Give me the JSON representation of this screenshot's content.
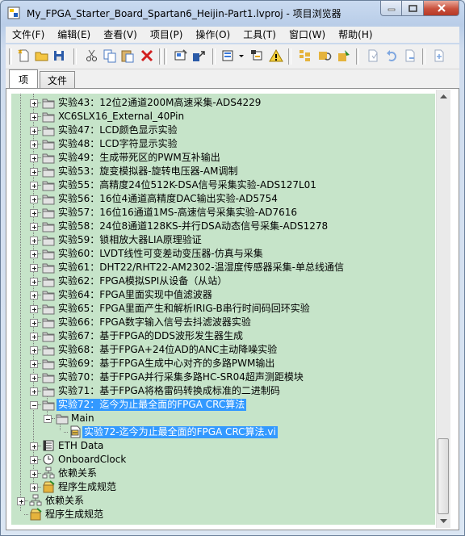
{
  "window": {
    "title": "My_FPGA_Starter_Board_Spartan6_Heijin-Part1.lvproj - 项目浏览器"
  },
  "menu": [
    "文件(F)",
    "编辑(E)",
    "查看(V)",
    "项目(P)",
    "操作(O)",
    "工具(T)",
    "窗口(W)",
    "帮助(H)"
  ],
  "toolbar": {
    "buttons": [
      "new-file",
      "open-folder",
      "save-all",
      "cut",
      "copy",
      "paste",
      "delete",
      "build",
      "deploy",
      "view-dropdown",
      "filter",
      "warning",
      "add-files",
      "refresh",
      "properties",
      "file-view",
      "undo",
      "redo",
      "add-item"
    ]
  },
  "tabs": [
    "项",
    "文件"
  ],
  "tree": {
    "items": [
      {
        "label": "实验43：12位2通道200M高速采集-ADS4229",
        "icon": "folder-icon"
      },
      {
        "label": "XC6SLX16_External_40Pin",
        "icon": "folder-icon"
      },
      {
        "label": "实验47：LCD颜色显示实验",
        "icon": "folder-icon"
      },
      {
        "label": "实验48：LCD字符显示实验",
        "icon": "folder-icon"
      },
      {
        "label": "实验49：生成带死区的PWM互补输出",
        "icon": "folder-icon"
      },
      {
        "label": "实验53：旋变模拟器-旋转电压器-AM调制",
        "icon": "folder-icon"
      },
      {
        "label": "实验55：高精度24位512K-DSA信号采集实验-ADS127L01",
        "icon": "folder-icon"
      },
      {
        "label": "实验56：16位4通道高精度DAC输出实验-AD5754",
        "icon": "folder-icon"
      },
      {
        "label": "实验57：16位16通道1MS-高速信号采集实验-AD7616",
        "icon": "folder-icon"
      },
      {
        "label": "实验58：24位8通道128KS-并行DSA动态信号采集-ADS1278",
        "icon": "folder-icon"
      },
      {
        "label": "实验59：锁相放大器LIA原理验证",
        "icon": "folder-icon"
      },
      {
        "label": "实验60：LVDT线性可变差动变压器-仿真与采集",
        "icon": "folder-icon"
      },
      {
        "label": "实验61：DHT22/RHT22-AM2302-温湿度传感器采集-单总线通信",
        "icon": "folder-icon"
      },
      {
        "label": "实验62：FPGA模拟SPI从设备（从站）",
        "icon": "folder-icon"
      },
      {
        "label": "实验64：FPGA里面实现中值滤波器",
        "icon": "folder-icon"
      },
      {
        "label": "实验65：FPGA里面产生和解析IRIG-B串行时间码回环实验",
        "icon": "folder-icon"
      },
      {
        "label": "实验66：FPGA数字输入信号去抖滤波器实验",
        "icon": "folder-icon"
      },
      {
        "label": "实验67：基于FPGA的DDS波形发生器生成",
        "icon": "folder-icon"
      },
      {
        "label": "实验68：基于FPGA+24位AD的ANC主动降噪实验",
        "icon": "folder-icon"
      },
      {
        "label": "实验69：基于FPGA生成中心对齐的多路PWM输出",
        "icon": "folder-icon"
      },
      {
        "label": "实验70：基于FPGA并行采集多路HC-SR04超声测距模块",
        "icon": "folder-icon"
      },
      {
        "label": "实验71：基于FPGA将格雷码转换成标准的二进制码",
        "icon": "folder-icon"
      },
      {
        "label": "实验72：迄今为止最全面的FPGA CRC算法",
        "icon": "folder-icon"
      },
      {
        "label": "Main",
        "icon": "folder-icon"
      },
      {
        "label": "实验72-迄今为止最全面的FPGA CRC算法.vi",
        "icon": "vi-file-icon"
      },
      {
        "label": "ETH Data",
        "icon": "data-icon"
      },
      {
        "label": "OnboardClock",
        "icon": "clock-icon"
      },
      {
        "label": "依赖关系",
        "icon": "dependencies-icon"
      },
      {
        "label": "程序生成规范",
        "icon": "build-spec-icon"
      },
      {
        "label": "依赖关系",
        "icon": "dependencies-icon"
      },
      {
        "label": "程序生成规范",
        "icon": "build-spec-icon"
      }
    ]
  },
  "colors": {
    "tree_background": "#c6e4c9",
    "selection": "#3399ff"
  }
}
